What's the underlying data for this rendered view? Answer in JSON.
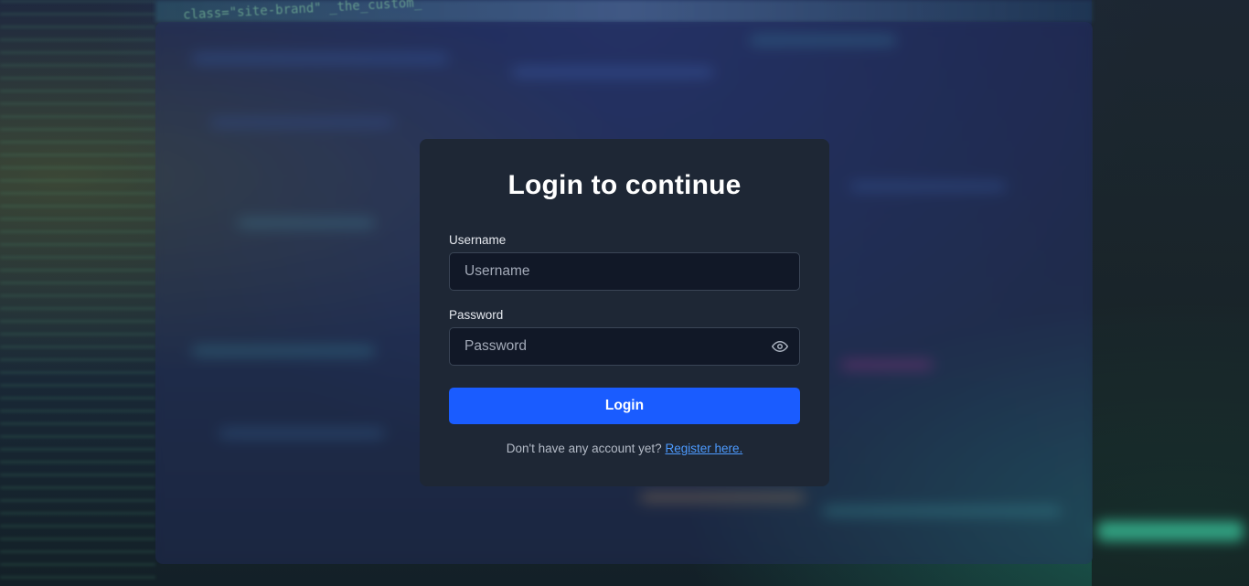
{
  "background": {
    "code_snippet": "class=\"site-brand\" _the_custom_"
  },
  "login_card": {
    "title": "Login to continue",
    "username": {
      "label": "Username",
      "placeholder": "Username",
      "value": ""
    },
    "password": {
      "label": "Password",
      "placeholder": "Password",
      "value": "",
      "toggle_icon": "eye-icon"
    },
    "submit_label": "Login",
    "register_prompt": "Don't have any account yet?",
    "register_link": "Register here."
  },
  "colors": {
    "card_bg": "#1e2735",
    "input_bg": "#111827",
    "primary_button": "#1a5cff",
    "link": "#4d9bff"
  }
}
